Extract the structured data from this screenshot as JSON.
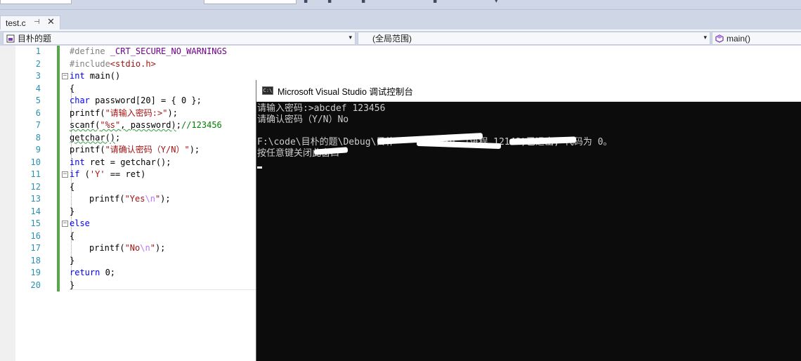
{
  "tab": {
    "label": "test.c",
    "pin": "⊣",
    "close": "✕"
  },
  "navbar": {
    "project": "目朴的题",
    "scope": "(全局范围)",
    "member": "main()",
    "arrow": "▾"
  },
  "editor": {
    "lines": [
      {
        "n": "1"
      },
      {
        "n": "2"
      },
      {
        "n": "3"
      },
      {
        "n": "4"
      },
      {
        "n": "5"
      },
      {
        "n": "6"
      },
      {
        "n": "7"
      },
      {
        "n": "8"
      },
      {
        "n": "9"
      },
      {
        "n": "10"
      },
      {
        "n": "11"
      },
      {
        "n": "12"
      },
      {
        "n": "13"
      },
      {
        "n": "14"
      },
      {
        "n": "15"
      },
      {
        "n": "16"
      },
      {
        "n": "17"
      },
      {
        "n": "18"
      },
      {
        "n": "19"
      },
      {
        "n": "20"
      }
    ],
    "code": {
      "l1_a": "#define ",
      "l1_b": "_CRT_SECURE_NO_WARNINGS",
      "l2_a": "#include",
      "l2_b": "<stdio.h>",
      "l3_a": "int",
      "l3_b": " main()",
      "l4": "{",
      "l5_a": "char",
      "l5_b": " password[20] = { 0 };",
      "l6_a": "printf(",
      "l6_b": "\"请输入密码:>\"",
      "l6_c": ");",
      "l7_a": "scanf(",
      "l7_b": "\"%s\"",
      "l7_c": ", password)",
      "l7_d": ";",
      "l7_e": "//123456",
      "l8_a": "getchar()",
      "l8_b": ";",
      "l9_a": "printf(",
      "l9_b": "\"请确认密码（Y/N）\"",
      "l9_c": ");",
      "l10_a": "int",
      "l10_b": " ret = getchar();",
      "l11_a": "if",
      "l11_b": " (",
      "l11_c": "'Y'",
      "l11_d": " == ret)",
      "l12": "{",
      "l13_a": "printf(",
      "l13_b": "\"Yes",
      "l13_c": "\\n",
      "l13_d": "\"",
      "l13_e": ");",
      "l14": "}",
      "l15": "else",
      "l16": "{",
      "l17_a": "printf(",
      "l17_b": "\"No",
      "l17_c": "\\n",
      "l17_d": "\"",
      "l17_e": ");",
      "l18": "}",
      "l19_a": "return",
      "l19_b": " 0;",
      "l20": "}"
    }
  },
  "console": {
    "title": "Microsoft Visual Studio 调试控制台",
    "icon_text": "C:\\",
    "lines": [
      "请输入密码:>abcdef 123456",
      "请确认密码（Y/N）No",
      "",
      "F:\\code\\目朴的题\\Debug\\目朴        exe （进程 12148)已退出, 代码为 0。",
      "按任意键关闭此窗口"
    ]
  }
}
